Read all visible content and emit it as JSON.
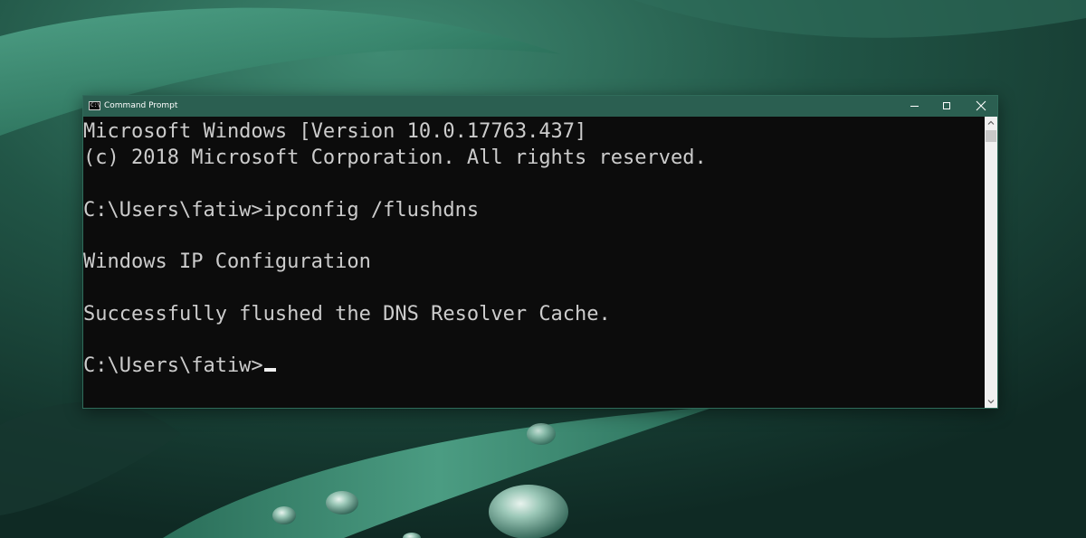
{
  "window": {
    "title": "Command Prompt",
    "icon": "cmd-icon",
    "icon_glyph": "C:\\",
    "controls": {
      "minimize": "minimize-icon",
      "maximize": "maximize-icon",
      "close": "close-icon"
    },
    "titlebar_color": "#2b5f51",
    "console_background": "#0c0c0c",
    "console_text_color": "#cccccc"
  },
  "console": {
    "lines": [
      "Microsoft Windows [Version 10.0.17763.437]",
      "(c) 2018 Microsoft Corporation. All rights reserved.",
      "",
      "C:\\Users\\fatiw>ipconfig /flushdns",
      "",
      "Windows IP Configuration",
      "",
      "Successfully flushed the DNS Resolver Cache.",
      "",
      "C:\\Users\\fatiw>"
    ],
    "scroll_position": 0
  }
}
